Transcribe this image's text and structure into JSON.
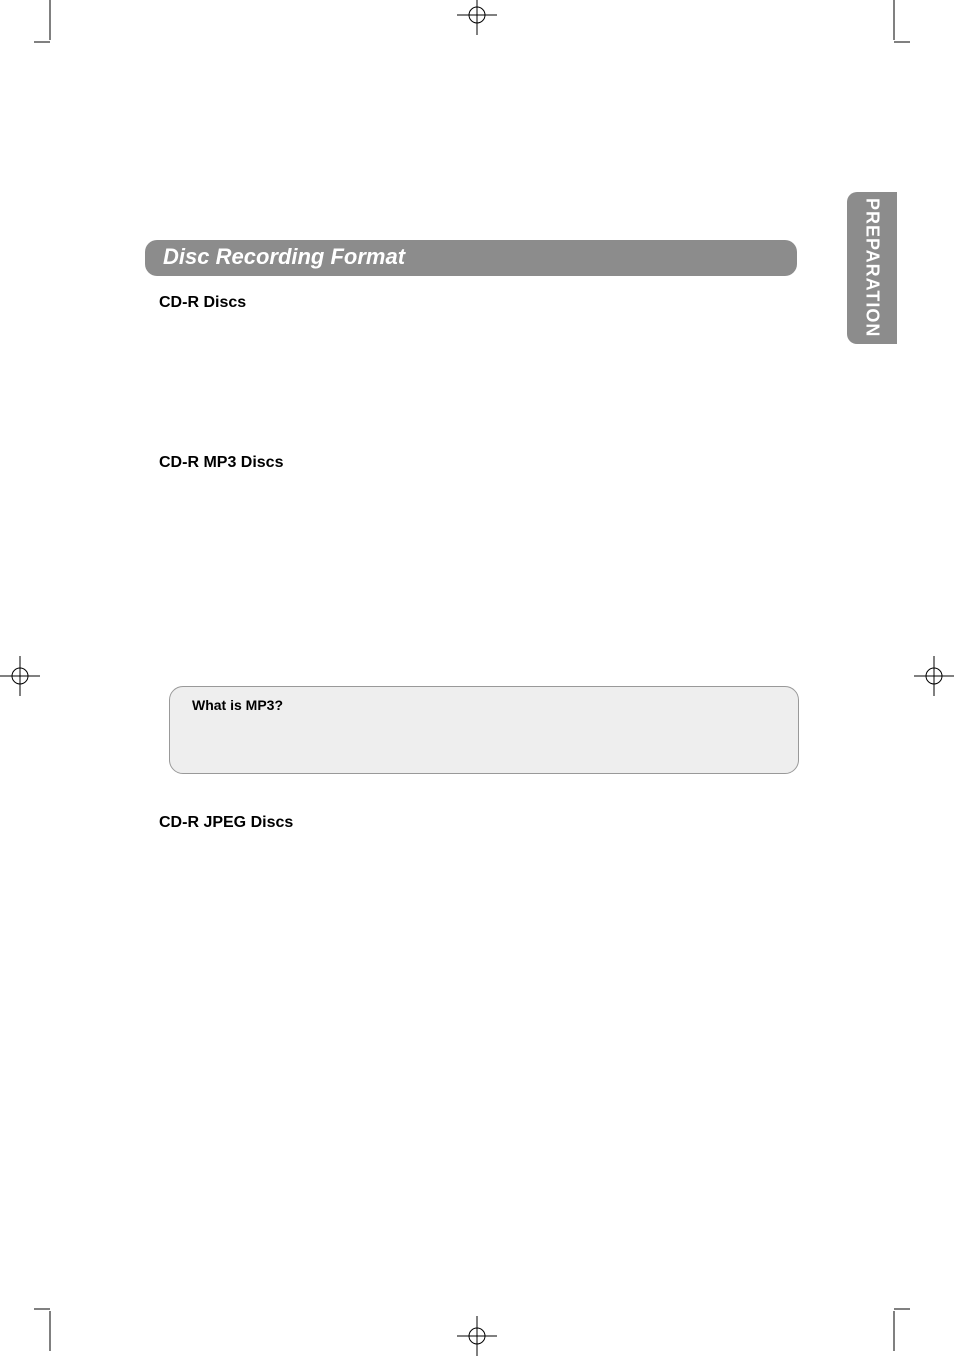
{
  "side_tab": {
    "label": "PREPARATION"
  },
  "section": {
    "title": "Disc Recording Format"
  },
  "subheadings": {
    "cdr": "CD-R Discs",
    "mp3": "CD-R MP3 Discs",
    "jpeg": "CD-R JPEG Discs"
  },
  "callout": {
    "title": "What is MP3?"
  }
}
